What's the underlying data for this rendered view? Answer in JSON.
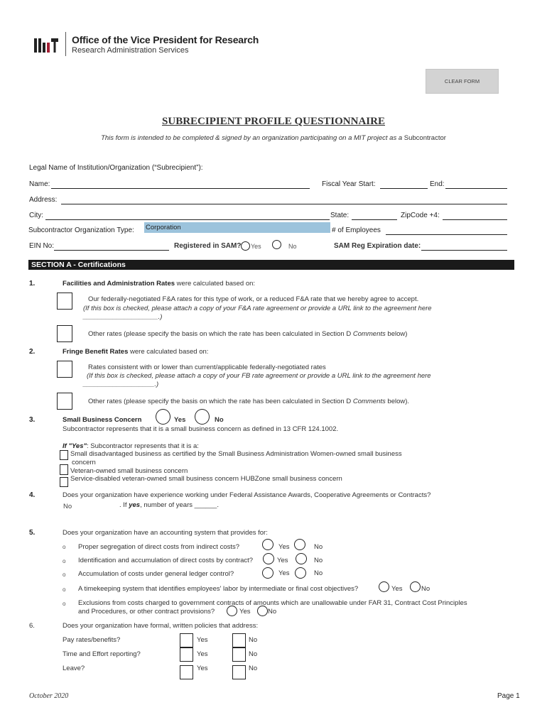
{
  "header": {
    "office_title": "Office of the Vice President for Research",
    "office_subtitle": "Research Administration Services",
    "clear_form_label": "CLEAR FORM"
  },
  "form": {
    "title": "SUBRECIPIENT PROFILE QUESTIONNAIRE",
    "subtitle_italic": "This form is intended to be completed & signed by an organization participating on a MIT project as a",
    "subtitle_plain": " Subcontractor",
    "legal_name_heading": "Legal Name of Institution/Organization (“Subrecipient”):",
    "name_label": "Name:",
    "fiscal_year_start_label": "Fiscal Year Start:",
    "end_label": "End:",
    "address_label": "Address:",
    "city_label": "City:",
    "state_label": "State:",
    "zipcode_label": "ZipCode +4:",
    "org_type_label": "Subcontractor Organization Type:",
    "org_type_value": "Corporation",
    "employees_label": "# of Employees",
    "ein_label": "EIN No:",
    "sam_label": "Registered in SAM?",
    "sam_yes": "Yes",
    "sam_no": "No",
    "sam_exp_label": "SAM Reg Expiration date:"
  },
  "section_a": {
    "title": "SECTION A - Certifications",
    "q1": {
      "number": "1.",
      "bold": "Facilities and Administration Rates",
      "text": " were calculated based on:",
      "opt1_text": "Our federally-negotiated F&A rates for this type of work, or a reduced F&A rate that we hereby agree to accept.",
      "opt1_note": "(If this box is checked, please attach a copy of your F&A rate agreement or provide a URL link to the agreement here",
      "opt1_note_end": "____________________.)",
      "opt2_text": "Other rates (please specify the basis on which the rate has been calculated in Section D ",
      "opt2_italic": "Comments",
      "opt2_end": " below)"
    },
    "q2": {
      "number": "2.",
      "bold": "Fringe Benefit Rates",
      "text": " were calculated based on:",
      "opt1_text": "Rates consistent with or lower than current/applicable federally-negotiated rates",
      "opt1_note": "(If this box is checked, please attach a copy of your FB rate agreement or provide a URL link to the agreement here",
      "opt1_note_end": "___________________.)",
      "opt2_text": "Other rates (please specify the basis on which the rate has been calculated in Section D ",
      "opt2_italic": "Comments",
      "opt2_end": " below)."
    },
    "q3": {
      "number": "3.",
      "bold": "Small Business Concern",
      "yes": "Yes",
      "no": "No",
      "text": "Subcontractor represents that it is a small business concern as defined in 13 CFR 124.1002.",
      "if_yes_bold": "If \"Yes\"",
      "if_yes_text": ": Subcontractor represents that it is a:",
      "opt1": "Small disadvantaged business as certified by the Small Business Administration Women-owned small business",
      "opt1_cont": "concern",
      "opt2": "Veteran-owned small business concern",
      "opt3": "Service-disabled veteran-owned small business concern HUBZone small business concern"
    },
    "q4": {
      "number": "4.",
      "text": "Does your organization have experience working under Federal Assistance Awards, Cooperative Agreements or Contracts?",
      "answer": "No",
      "if_yes_pre": ".  If ",
      "if_yes_bold": "yes",
      "if_yes_post": ", number of years ______."
    },
    "q5": {
      "number": "5.",
      "text": "Does your organization have an accounting system that provides for:",
      "bullet": "o",
      "items": [
        {
          "text": "Proper segregation of direct costs from indirect costs?",
          "yes": "Yes",
          "no": "No"
        },
        {
          "text": "Identification and accumulation of direct costs by contract?",
          "yes": "Yes",
          "no": "No"
        },
        {
          "text": "Accumulation of costs under general ledger control?",
          "yes": "Yes",
          "no": "No"
        },
        {
          "text": "A timekeeping system that identifies employees' labor by intermediate or final cost objectives?",
          "yes": "Yes",
          "no": "No"
        },
        {
          "text": "Exclusions from costs charged to government contracts of amounts which are unallowable under FAR 31, Contract Cost Principles",
          "text2": "and Procedures, or other contract provisions?",
          "yes": "Yes",
          "no": "No"
        }
      ]
    },
    "q6": {
      "number": "6.",
      "text": "Does your organization have formal, written policies that address:",
      "items": [
        {
          "text": "Pay rates/benefits?",
          "yes": "Yes",
          "no": "No"
        },
        {
          "text": "Time and Effort reporting?",
          "yes": "Yes",
          "no": "No"
        },
        {
          "text": "Leave?",
          "yes": "Yes",
          "no": "No"
        }
      ]
    }
  },
  "footer": {
    "date": "October 2020",
    "page": "Page 1"
  }
}
